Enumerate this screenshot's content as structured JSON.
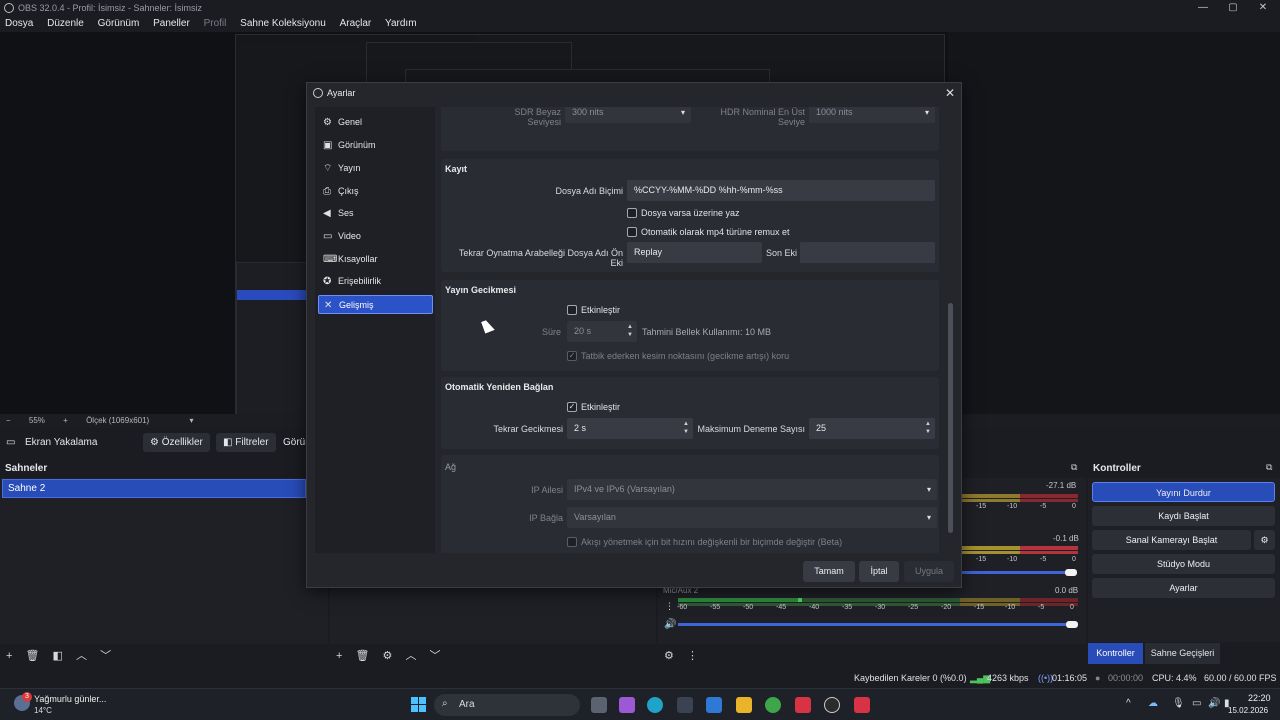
{
  "window": {
    "title": "OBS 32.0.4 - Profil: İsimsiz - Sahneler: İsimsiz",
    "minimize": "—",
    "maximize": "▢",
    "close": "✕"
  },
  "menu": {
    "items": [
      "Dosya",
      "Düzenle",
      "Görünüm",
      "Paneller",
      "Profil",
      "Sahne Koleksiyonu",
      "Araçlar",
      "Yardım"
    ]
  },
  "preview_toolbar": {
    "zoom": "55%",
    "scale": "Ölçek (1069x601)"
  },
  "context_bar": {
    "source": "Ekran Yakalama",
    "properties": "Özellikler",
    "filters": "Filtreler",
    "partial": "Görün"
  },
  "scenes": {
    "title": "Sahneler",
    "items": [
      "Sahne 2"
    ]
  },
  "mixer": {
    "rows": [
      {
        "db": "-27.1 dB"
      },
      {
        "db": "-0.1 dB"
      },
      {
        "name": "Mic/Aux 2",
        "db": "0.0 dB"
      }
    ],
    "scale": [
      "-60",
      "-55",
      "-50",
      "-45",
      "-40",
      "-35",
      "-30",
      "-25",
      "-20",
      "-15",
      "-10",
      "-5",
      "0"
    ],
    "scale_short": [
      "-15",
      "-10",
      "-5",
      "0"
    ]
  },
  "controls": {
    "title": "Kontroller",
    "stop_stream": "Yayını Durdur",
    "start_recording": "Kaydı Başlat",
    "start_virtual_cam": "Sanal Kamerayı Başlat",
    "studio_mode": "Stüdyo Modu",
    "settings": "Ayarlar",
    "tab_controls": "Kontroller",
    "tab_transitions": "Sahne Geçişleri"
  },
  "status": {
    "dropped": "Kaybedilen Kareler 0 (%0.0)",
    "bitrate": "4263 kbps",
    "stream_time": "01:16:05",
    "rec_time": "00:00:00",
    "cpu": "CPU: 4.4%",
    "fps": "60.00 / 60.00 FPS"
  },
  "taskbar": {
    "weather": "Yağmurlu günler...",
    "temp": "14°C",
    "weather_badge": "3",
    "search": "Ara",
    "time": "22:20",
    "date": "15.02.2026"
  },
  "dialog": {
    "title": "Ayarlar",
    "nav": [
      "Genel",
      "Görünüm",
      "Yayın",
      "Çıkış",
      "Ses",
      "Video",
      "Kısayollar",
      "Erişebilirlik",
      "Gelişmiş"
    ],
    "nav_icons": [
      "⚙",
      "▣",
      "⌔",
      "⎙",
      "◀",
      "▭",
      "⌨",
      "✪",
      "✕"
    ],
    "active_nav": "Gelişmiş",
    "top_partial": {
      "sdr_label": "SDR Beyaz Seviyesi",
      "sdr_value": "300 nits",
      "hdr_label": "HDR Nominal En Üst Seviye",
      "hdr_value": "1000 nits"
    },
    "recording": {
      "title": "Kayıt",
      "filename_label": "Dosya Adı Biçimi",
      "filename_value": "%CCYY-%MM-%DD %hh-%mm-%ss",
      "overwrite": "Dosya varsa üzerine yaz",
      "remux": "Otomatik olarak mp4 türüne remux et",
      "replay_label": "Tekrar Oynatma Arabelleği Dosya Adı Ön Eki",
      "replay_value": "Replay",
      "suffix_label": "Son Eki",
      "suffix_value": ""
    },
    "stream_delay": {
      "title": "Yayın Gecikmesi",
      "enable": "Etkinleştir",
      "duration_label": "Süre",
      "duration_value": "20 s",
      "memory": "Tahmini Bellek Kullanımı: 10 MB",
      "preserve": "Tatbik ederken kesim noktasını (gecikme artışı) koru"
    },
    "reconnect": {
      "title": "Otomatik Yeniden Bağlan",
      "enable": "Etkinleştir",
      "delay_label": "Tekrar Gecikmesi",
      "delay_value": "2 s",
      "retries_label": "Maksimum Deneme Sayısı",
      "retries_value": "25"
    },
    "network": {
      "title": "Ağ",
      "ip_family_label": "IP Ailesi",
      "ip_family_value": "IPv4 ve IPv6 (Varsayılan)",
      "bind_label": "IP Bağla",
      "bind_value": "Varsayılan",
      "dynamic_bitrate": "Akışı yönetmek için bit hızını değişkenli bir biçimde değiştir (Beta)"
    },
    "buttons": {
      "ok": "Tamam",
      "cancel": "İptal",
      "apply": "Uygula"
    }
  }
}
